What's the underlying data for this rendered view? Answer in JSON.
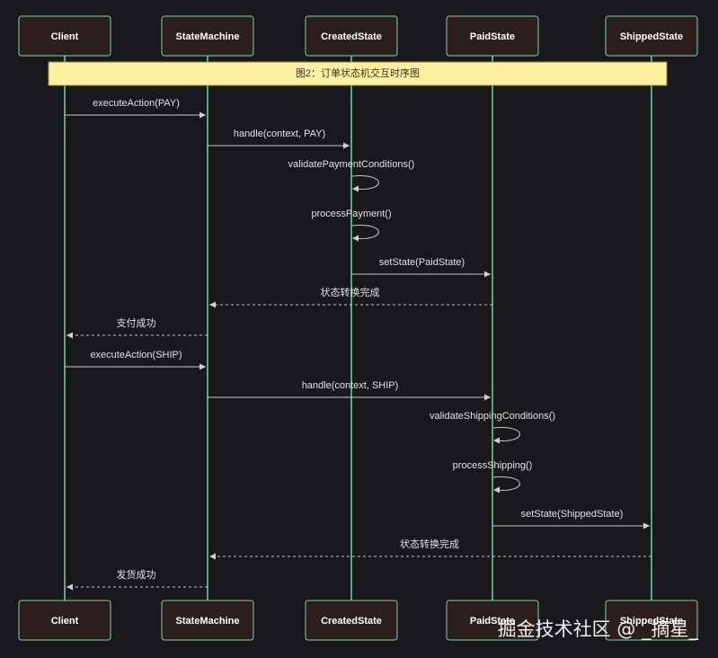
{
  "participants": [
    {
      "id": "client",
      "label": "Client"
    },
    {
      "id": "sm",
      "label": "StateMachine"
    },
    {
      "id": "created",
      "label": "CreatedState"
    },
    {
      "id": "paid",
      "label": "PaidState"
    },
    {
      "id": "shipped",
      "label": "ShippedState"
    }
  ],
  "note": {
    "text": "图2：订单状态机交互时序图"
  },
  "messages": [
    {
      "from": "client",
      "to": "sm",
      "label": "executeAction(PAY)",
      "style": "solid"
    },
    {
      "from": "sm",
      "to": "created",
      "label": "handle(context, PAY)",
      "style": "solid"
    },
    {
      "from": "created",
      "to": "created",
      "label": "validatePaymentConditions()",
      "style": "self"
    },
    {
      "from": "created",
      "to": "created",
      "label": "processPayment()",
      "style": "self"
    },
    {
      "from": "created",
      "to": "paid",
      "label": "setState(PaidState)",
      "style": "solid"
    },
    {
      "from": "paid",
      "to": "sm",
      "label": "状态转换完成",
      "style": "dashed"
    },
    {
      "from": "sm",
      "to": "client",
      "label": "支付成功",
      "style": "dashed"
    },
    {
      "from": "client",
      "to": "sm",
      "label": "executeAction(SHIP)",
      "style": "solid"
    },
    {
      "from": "sm",
      "to": "paid",
      "label": "handle(context, SHIP)",
      "style": "solid"
    },
    {
      "from": "paid",
      "to": "paid",
      "label": "validateShippingConditions()",
      "style": "self"
    },
    {
      "from": "paid",
      "to": "paid",
      "label": "processShipping()",
      "style": "self"
    },
    {
      "from": "paid",
      "to": "shipped",
      "label": "setState(ShippedState)",
      "style": "solid"
    },
    {
      "from": "shipped",
      "to": "sm",
      "label": "状态转换完成",
      "style": "dashed"
    },
    {
      "from": "sm",
      "to": "client",
      "label": "发货成功",
      "style": "dashed"
    }
  ],
  "watermark": "掘金技术社区 @ _摘星_",
  "colors": {
    "background": "#19181d",
    "lifeline": "#63d08a",
    "box_fill": "#2b1f1d",
    "note_fill": "#fdf1a0",
    "arrow": "#c9c9c9"
  }
}
